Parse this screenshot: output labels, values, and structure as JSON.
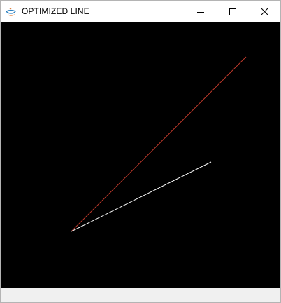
{
  "window": {
    "title": "OPTIMIZED LINE",
    "icon": "java-coffee-cup-icon",
    "controls": {
      "minimize_icon": "minimize-icon",
      "maximize_icon": "maximize-icon",
      "close_icon": "close-icon"
    }
  },
  "drawing": {
    "background_color": "#000000",
    "lines": [
      {
        "name": "red-line",
        "color": "#c0392b"
      },
      {
        "name": "white-line",
        "color": "#ffffff"
      }
    ]
  },
  "status_strip_color": "#f0f0f0"
}
